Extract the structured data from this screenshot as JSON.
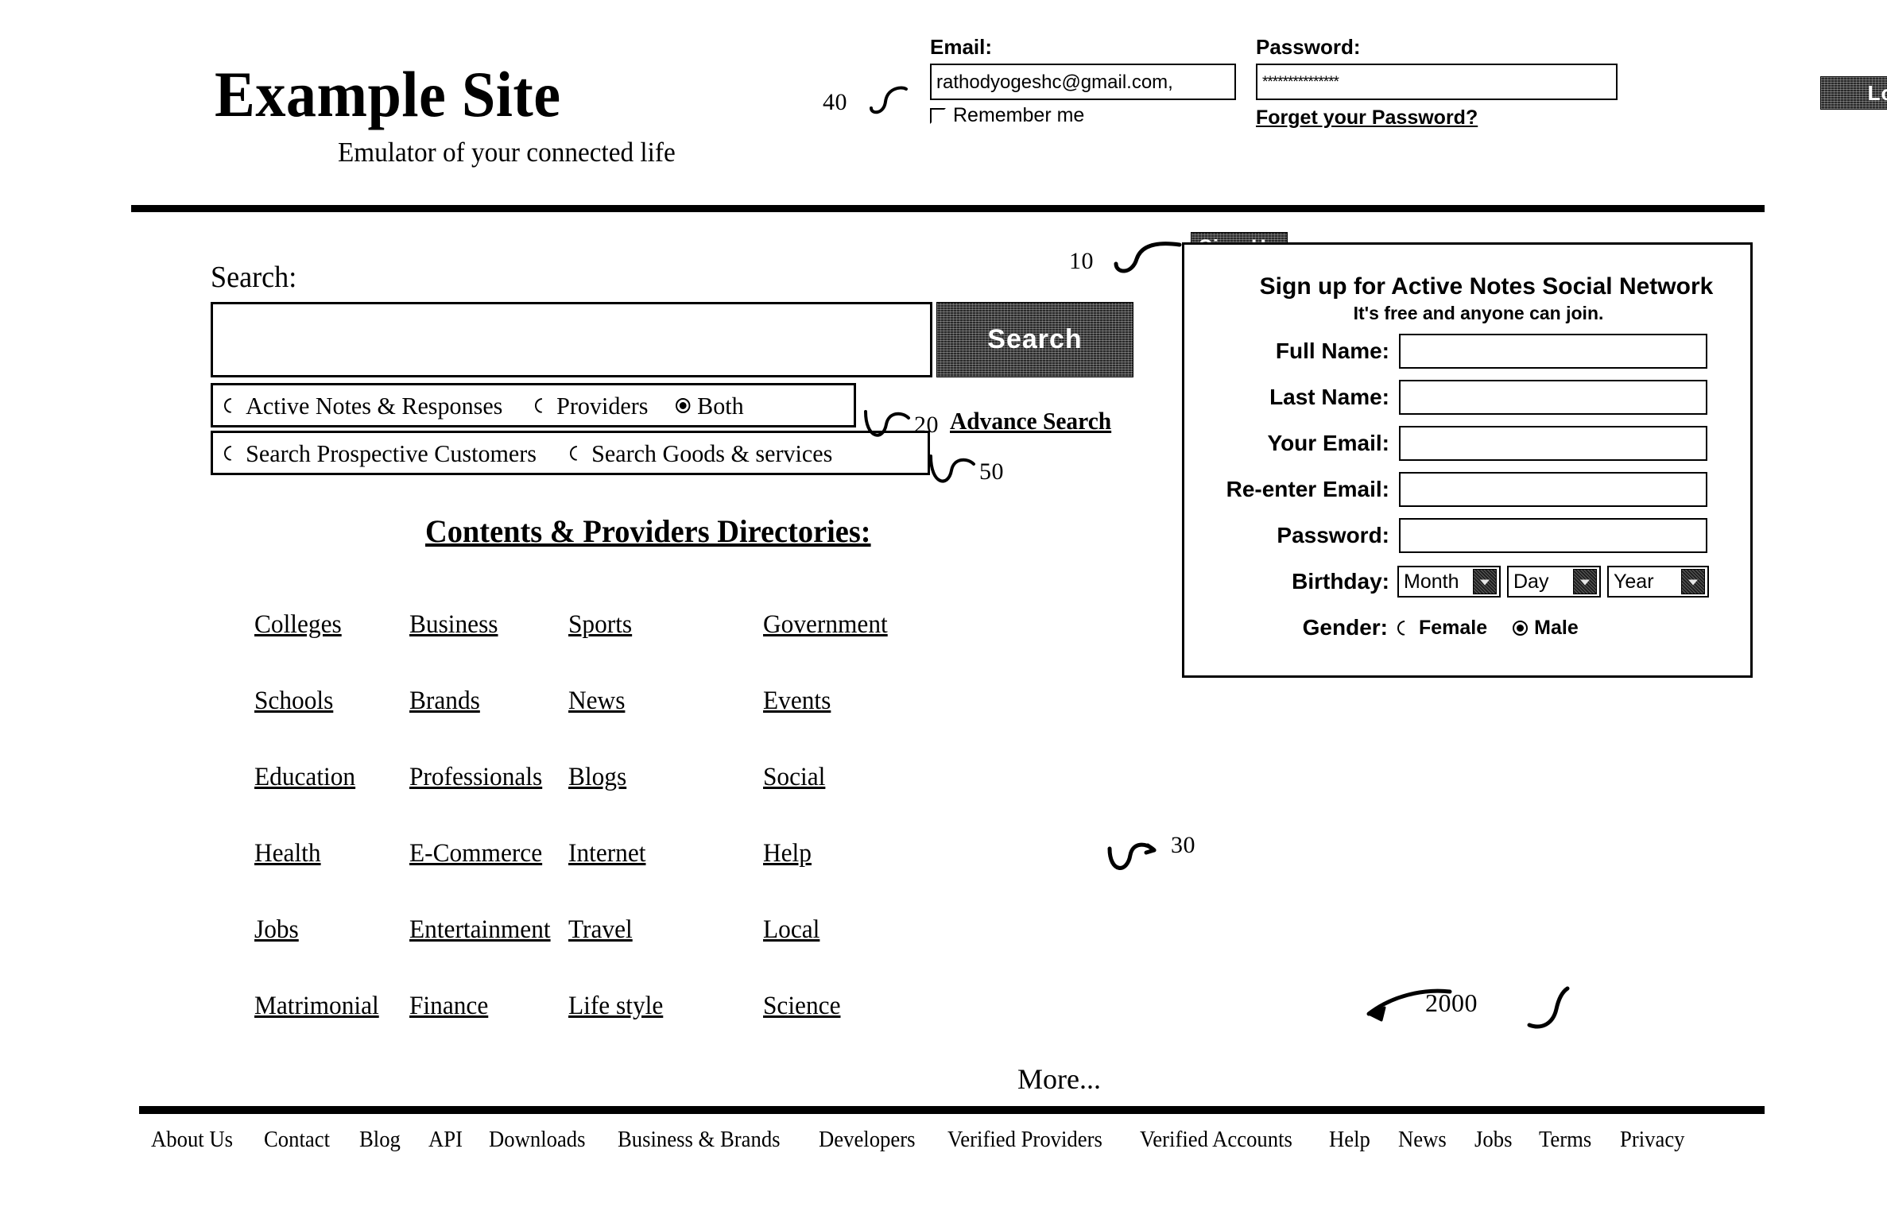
{
  "brand": {
    "title": "Example Site",
    "tagline": "Emulator of your connected life"
  },
  "callouts": {
    "header": "40",
    "signup": "10",
    "filters_primary": "20",
    "filters_secondary": "50",
    "directories": "30",
    "page": "2000"
  },
  "login": {
    "email_label": "Email:",
    "email_value": "rathodyogeshc@gmail.com,",
    "remember_label": "Remember me",
    "password_label": "Password:",
    "password_value": "***************",
    "forgot_label": "Forget your Password?",
    "login_button": "Login"
  },
  "search": {
    "label": "Search:",
    "value": "",
    "placeholder": "",
    "button": "Search",
    "advance_search": "Advance Search",
    "filters_primary": [
      {
        "label": "Active Notes & Responses",
        "selected": false
      },
      {
        "label": "Providers",
        "selected": false
      },
      {
        "label": "Both",
        "selected": true
      }
    ],
    "filters_secondary": [
      {
        "label": "Search Prospective Customers",
        "selected": false
      },
      {
        "label": "Search Goods & services",
        "selected": false
      }
    ]
  },
  "directories": {
    "heading": "Contents & Providers Directories:",
    "links": [
      "Colleges",
      "Business",
      "Sports",
      "Government",
      "Schools",
      "Brands",
      "News",
      "Events",
      "Education",
      "Professionals",
      "Blogs",
      "Social",
      "Health",
      "E-Commerce",
      "Internet",
      "Help",
      "Jobs",
      "Entertainment",
      "Travel",
      "Local",
      "Matrimonial",
      "Finance",
      "Life style",
      "Science"
    ],
    "more": "More..."
  },
  "signup": {
    "tab_label": "Sign Up",
    "title": "Sign up for Active Notes Social Network",
    "subtitle": "It's free and anyone can join.",
    "fields": [
      {
        "label": "Full Name:",
        "value": ""
      },
      {
        "label": "Last Name:",
        "value": ""
      },
      {
        "label": "Your Email:",
        "value": ""
      },
      {
        "label": "Re-enter Email:",
        "value": ""
      },
      {
        "label": "Password:",
        "value": ""
      }
    ],
    "birthday_label": "Birthday:",
    "birthday": {
      "month": "Month",
      "day": "Day",
      "year": "Year"
    },
    "gender_label": "Gender:",
    "gender": [
      {
        "label": "Female",
        "selected": false
      },
      {
        "label": "Male",
        "selected": true
      }
    ]
  },
  "footer": {
    "links": [
      "About Us",
      "Contact",
      "Blog",
      "API",
      "Downloads",
      "Business & Brands",
      "Developers",
      "Verified Providers",
      "Verified Accounts",
      "Help",
      "News",
      "Jobs",
      "Terms",
      "Privacy"
    ]
  },
  "colors": {
    "ink": "#000000",
    "paper": "#ffffff",
    "button_dark": "#2a2a2a"
  }
}
